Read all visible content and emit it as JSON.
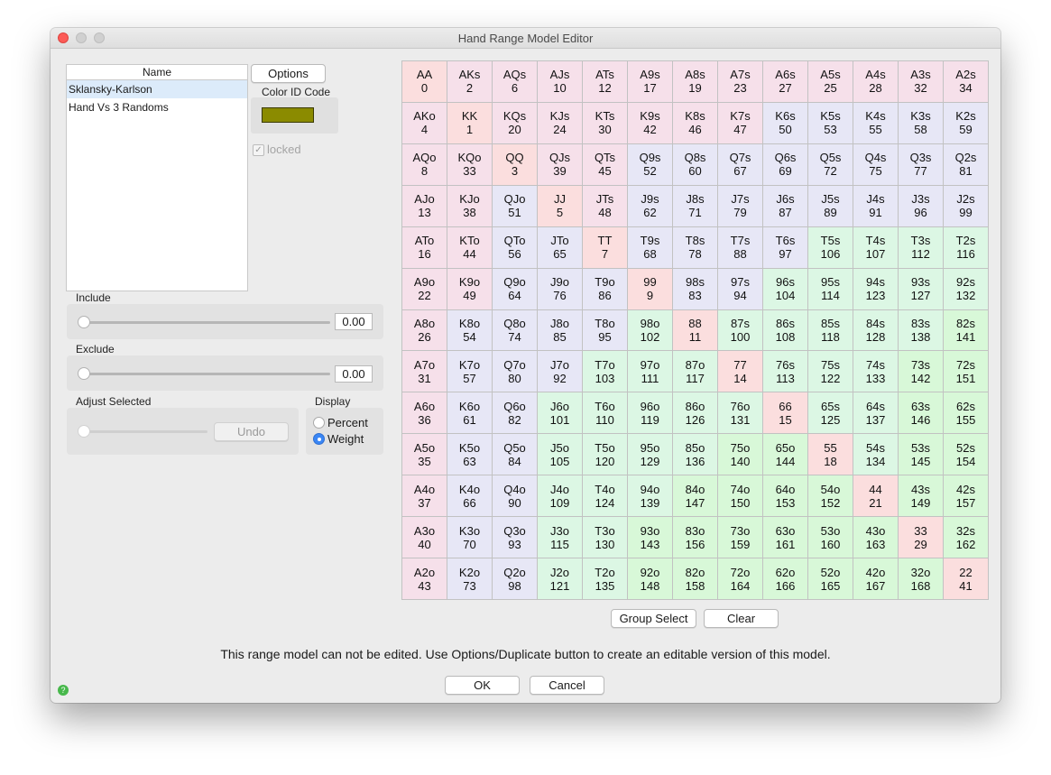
{
  "window": {
    "title": "Hand Range Model Editor"
  },
  "models": {
    "header": "Name",
    "items": [
      "Sklansky-Karlson",
      "Hand Vs 3 Randoms"
    ],
    "selected_index": 0
  },
  "options_button": "Options",
  "color_id": {
    "label": "Color ID Code",
    "color": "#8b8b00"
  },
  "locked": {
    "label": "locked",
    "checked": true
  },
  "include": {
    "label": "Include",
    "value": "0.00"
  },
  "exclude": {
    "label": "Exclude",
    "value": "0.00"
  },
  "adjust": {
    "label": "Adjust Selected",
    "undo_label": "Undo"
  },
  "display": {
    "label": "Display",
    "options": [
      "Percent",
      "Weight"
    ],
    "selected": "Weight"
  },
  "grid": {
    "colors": {
      "pair": "#fbdede",
      "high": "#f6e0ea",
      "mid": "#e7e7f6",
      "low": "#dcf7e4",
      "vlow": "#d8f8d8"
    },
    "rows": [
      [
        [
          "AA",
          "0"
        ],
        [
          "AKs",
          "2"
        ],
        [
          "AQs",
          "6"
        ],
        [
          "AJs",
          "10"
        ],
        [
          "ATs",
          "12"
        ],
        [
          "A9s",
          "17"
        ],
        [
          "A8s",
          "19"
        ],
        [
          "A7s",
          "23"
        ],
        [
          "A6s",
          "27"
        ],
        [
          "A5s",
          "25"
        ],
        [
          "A4s",
          "28"
        ],
        [
          "A3s",
          "32"
        ],
        [
          "A2s",
          "34"
        ]
      ],
      [
        [
          "AKo",
          "4"
        ],
        [
          "KK",
          "1"
        ],
        [
          "KQs",
          "20"
        ],
        [
          "KJs",
          "24"
        ],
        [
          "KTs",
          "30"
        ],
        [
          "K9s",
          "42"
        ],
        [
          "K8s",
          "46"
        ],
        [
          "K7s",
          "47"
        ],
        [
          "K6s",
          "50"
        ],
        [
          "K5s",
          "53"
        ],
        [
          "K4s",
          "55"
        ],
        [
          "K3s",
          "58"
        ],
        [
          "K2s",
          "59"
        ]
      ],
      [
        [
          "AQo",
          "8"
        ],
        [
          "KQo",
          "33"
        ],
        [
          "QQ",
          "3"
        ],
        [
          "QJs",
          "39"
        ],
        [
          "QTs",
          "45"
        ],
        [
          "Q9s",
          "52"
        ],
        [
          "Q8s",
          "60"
        ],
        [
          "Q7s",
          "67"
        ],
        [
          "Q6s",
          "69"
        ],
        [
          "Q5s",
          "72"
        ],
        [
          "Q4s",
          "75"
        ],
        [
          "Q3s",
          "77"
        ],
        [
          "Q2s",
          "81"
        ]
      ],
      [
        [
          "AJo",
          "13"
        ],
        [
          "KJo",
          "38"
        ],
        [
          "QJo",
          "51"
        ],
        [
          "JJ",
          "5"
        ],
        [
          "JTs",
          "48"
        ],
        [
          "J9s",
          "62"
        ],
        [
          "J8s",
          "71"
        ],
        [
          "J7s",
          "79"
        ],
        [
          "J6s",
          "87"
        ],
        [
          "J5s",
          "89"
        ],
        [
          "J4s",
          "91"
        ],
        [
          "J3s",
          "96"
        ],
        [
          "J2s",
          "99"
        ]
      ],
      [
        [
          "ATo",
          "16"
        ],
        [
          "KTo",
          "44"
        ],
        [
          "QTo",
          "56"
        ],
        [
          "JTo",
          "65"
        ],
        [
          "TT",
          "7"
        ],
        [
          "T9s",
          "68"
        ],
        [
          "T8s",
          "78"
        ],
        [
          "T7s",
          "88"
        ],
        [
          "T6s",
          "97"
        ],
        [
          "T5s",
          "106"
        ],
        [
          "T4s",
          "107"
        ],
        [
          "T3s",
          "112"
        ],
        [
          "T2s",
          "116"
        ]
      ],
      [
        [
          "A9o",
          "22"
        ],
        [
          "K9o",
          "49"
        ],
        [
          "Q9o",
          "64"
        ],
        [
          "J9o",
          "76"
        ],
        [
          "T9o",
          "86"
        ],
        [
          "99",
          "9"
        ],
        [
          "98s",
          "83"
        ],
        [
          "97s",
          "94"
        ],
        [
          "96s",
          "104"
        ],
        [
          "95s",
          "114"
        ],
        [
          "94s",
          "123"
        ],
        [
          "93s",
          "127"
        ],
        [
          "92s",
          "132"
        ]
      ],
      [
        [
          "A8o",
          "26"
        ],
        [
          "K8o",
          "54"
        ],
        [
          "Q8o",
          "74"
        ],
        [
          "J8o",
          "85"
        ],
        [
          "T8o",
          "95"
        ],
        [
          "98o",
          "102"
        ],
        [
          "88",
          "11"
        ],
        [
          "87s",
          "100"
        ],
        [
          "86s",
          "108"
        ],
        [
          "85s",
          "118"
        ],
        [
          "84s",
          "128"
        ],
        [
          "83s",
          "138"
        ],
        [
          "82s",
          "141"
        ]
      ],
      [
        [
          "A7o",
          "31"
        ],
        [
          "K7o",
          "57"
        ],
        [
          "Q7o",
          "80"
        ],
        [
          "J7o",
          "92"
        ],
        [
          "T7o",
          "103"
        ],
        [
          "97o",
          "111"
        ],
        [
          "87o",
          "117"
        ],
        [
          "77",
          "14"
        ],
        [
          "76s",
          "113"
        ],
        [
          "75s",
          "122"
        ],
        [
          "74s",
          "133"
        ],
        [
          "73s",
          "142"
        ],
        [
          "72s",
          "151"
        ]
      ],
      [
        [
          "A6o",
          "36"
        ],
        [
          "K6o",
          "61"
        ],
        [
          "Q6o",
          "82"
        ],
        [
          "J6o",
          "101"
        ],
        [
          "T6o",
          "110"
        ],
        [
          "96o",
          "119"
        ],
        [
          "86o",
          "126"
        ],
        [
          "76o",
          "131"
        ],
        [
          "66",
          "15"
        ],
        [
          "65s",
          "125"
        ],
        [
          "64s",
          "137"
        ],
        [
          "63s",
          "146"
        ],
        [
          "62s",
          "155"
        ]
      ],
      [
        [
          "A5o",
          "35"
        ],
        [
          "K5o",
          "63"
        ],
        [
          "Q5o",
          "84"
        ],
        [
          "J5o",
          "105"
        ],
        [
          "T5o",
          "120"
        ],
        [
          "95o",
          "129"
        ],
        [
          "85o",
          "136"
        ],
        [
          "75o",
          "140"
        ],
        [
          "65o",
          "144"
        ],
        [
          "55",
          "18"
        ],
        [
          "54s",
          "134"
        ],
        [
          "53s",
          "145"
        ],
        [
          "52s",
          "154"
        ]
      ],
      [
        [
          "A4o",
          "37"
        ],
        [
          "K4o",
          "66"
        ],
        [
          "Q4o",
          "90"
        ],
        [
          "J4o",
          "109"
        ],
        [
          "T4o",
          "124"
        ],
        [
          "94o",
          "139"
        ],
        [
          "84o",
          "147"
        ],
        [
          "74o",
          "150"
        ],
        [
          "64o",
          "153"
        ],
        [
          "54o",
          "152"
        ],
        [
          "44",
          "21"
        ],
        [
          "43s",
          "149"
        ],
        [
          "42s",
          "157"
        ]
      ],
      [
        [
          "A3o",
          "40"
        ],
        [
          "K3o",
          "70"
        ],
        [
          "Q3o",
          "93"
        ],
        [
          "J3o",
          "115"
        ],
        [
          "T3o",
          "130"
        ],
        [
          "93o",
          "143"
        ],
        [
          "83o",
          "156"
        ],
        [
          "73o",
          "159"
        ],
        [
          "63o",
          "161"
        ],
        [
          "53o",
          "160"
        ],
        [
          "43o",
          "163"
        ],
        [
          "33",
          "29"
        ],
        [
          "32s",
          "162"
        ]
      ],
      [
        [
          "A2o",
          "43"
        ],
        [
          "K2o",
          "73"
        ],
        [
          "Q2o",
          "98"
        ],
        [
          "J2o",
          "121"
        ],
        [
          "T2o",
          "135"
        ],
        [
          "92o",
          "148"
        ],
        [
          "82o",
          "158"
        ],
        [
          "72o",
          "164"
        ],
        [
          "62o",
          "166"
        ],
        [
          "52o",
          "165"
        ],
        [
          "42o",
          "167"
        ],
        [
          "32o",
          "168"
        ],
        [
          "22",
          "41"
        ]
      ]
    ]
  },
  "buttons": {
    "group_select": "Group Select",
    "clear": "Clear",
    "ok": "OK",
    "cancel": "Cancel"
  },
  "note": "This range model can not be edited. Use Options/Duplicate button to create an editable version of this model."
}
